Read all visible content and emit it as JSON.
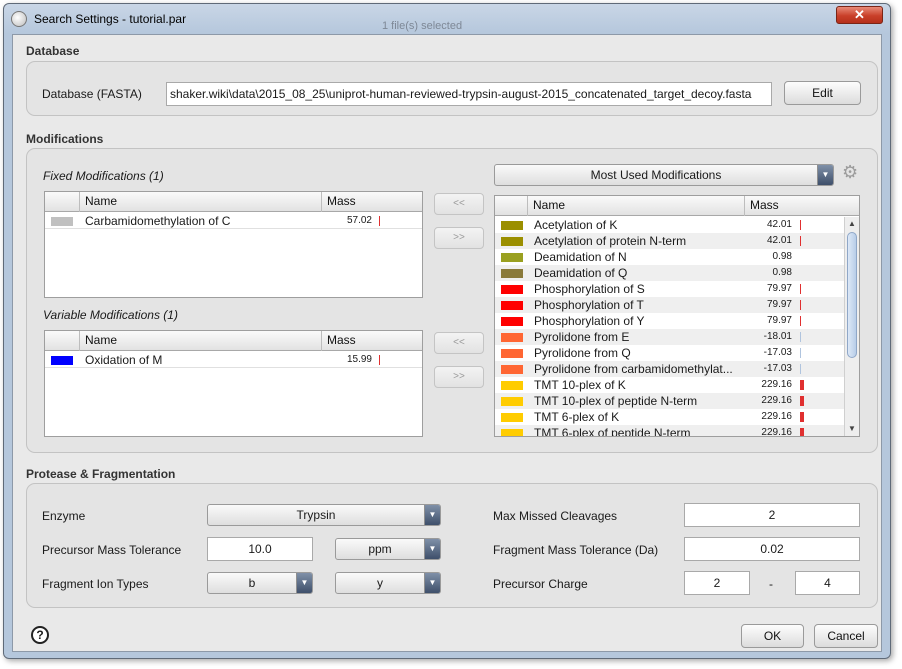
{
  "window": {
    "title": "Search Settings - tutorial.par",
    "ghost_text": "1 file(s) selected",
    "close_symbol": "✕"
  },
  "database": {
    "section_title": "Database",
    "label": "Database (FASTA)",
    "value": "shaker.wiki\\data\\2015_08_25\\uniprot-human-reviewed-trypsin-august-2015_concatenated_target_decoy.fasta",
    "edit_label": "Edit"
  },
  "modifications": {
    "section_title": "Modifications",
    "fixed_title": "Fixed Modifications (1)",
    "variable_title": "Variable Modifications (1)",
    "col_name": "Name",
    "col_mass": "Mass",
    "fixed": [
      {
        "name": "Carbamidomethylation of C",
        "mass": "57.02",
        "color": "#c0c0c0"
      }
    ],
    "variable": [
      {
        "name": "Oxidation of M",
        "mass": "15.99",
        "color": "#0000ff"
      }
    ],
    "move_left_label": "<<",
    "move_right_label": ">>",
    "list_selector": "Most Used Modifications",
    "gear_icon": "⚙",
    "available": [
      {
        "name": "Acetylation of K",
        "mass": "42.01",
        "color": "#9b8f00"
      },
      {
        "name": "Acetylation of protein N-term",
        "mass": "42.01",
        "color": "#9b8f00"
      },
      {
        "name": "Deamidation of N",
        "mass": "0.98",
        "color": "#9aa020"
      },
      {
        "name": "Deamidation of Q",
        "mass": "0.98",
        "color": "#8a7a3a"
      },
      {
        "name": "Phosphorylation of S",
        "mass": "79.97",
        "color": "#ff0000"
      },
      {
        "name": "Phosphorylation of T",
        "mass": "79.97",
        "color": "#ff0000"
      },
      {
        "name": "Phosphorylation of Y",
        "mass": "79.97",
        "color": "#ff0000"
      },
      {
        "name": "Pyrolidone from E",
        "mass": "-18.01",
        "color": "#ff6633"
      },
      {
        "name": "Pyrolidone from Q",
        "mass": "-17.03",
        "color": "#ff6633"
      },
      {
        "name": "Pyrolidone from carbamidomethylat...",
        "mass": "-17.03",
        "color": "#ff6633"
      },
      {
        "name": "TMT 10-plex of K",
        "mass": "229.16",
        "color": "#ffcc00"
      },
      {
        "name": "TMT 10-plex of peptide N-term",
        "mass": "229.16",
        "color": "#ffcc00"
      },
      {
        "name": "TMT 6-plex of K",
        "mass": "229.16",
        "color": "#ffcc00"
      },
      {
        "name": "TMT 6-plex of peptide N-term",
        "mass": "229.16",
        "color": "#ffcc00"
      }
    ]
  },
  "protease": {
    "section_title": "Protease & Fragmentation",
    "enzyme_label": "Enzyme",
    "enzyme_value": "Trypsin",
    "precursor_tol_label": "Precursor Mass Tolerance",
    "precursor_tol_value": "10.0",
    "precursor_tol_unit": "ppm",
    "ion_types_label": "Fragment Ion Types",
    "ion_type_1": "b",
    "ion_type_2": "y",
    "max_missed_label": "Max Missed Cleavages",
    "max_missed_value": "2",
    "fragment_tol_label": "Fragment Mass Tolerance (Da)",
    "fragment_tol_value": "0.02",
    "charge_label": "Precursor Charge",
    "charge_min": "2",
    "charge_sep": "-",
    "charge_max": "4"
  },
  "footer": {
    "help_symbol": "?",
    "ok_label": "OK",
    "cancel_label": "Cancel"
  }
}
